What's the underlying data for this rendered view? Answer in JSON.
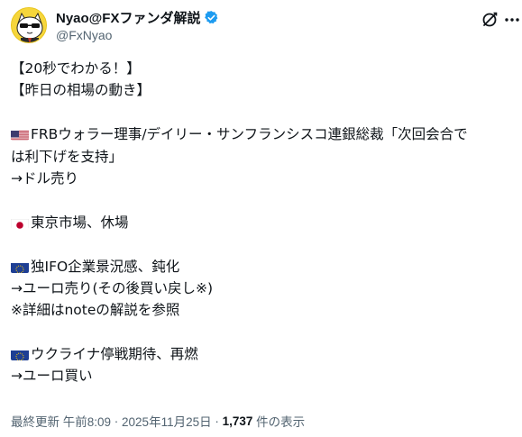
{
  "author": {
    "display_name": "Nyao@FXファンダ解説",
    "handle": "@FxNyao"
  },
  "tweet": {
    "lines": [
      {
        "text": "【20秒でわかる！】"
      },
      {
        "text": "【昨日の相場の動き】"
      },
      {
        "text": ""
      },
      {
        "flag": "us-flag-icon",
        "text": "FRBウォラー理事/デイリー・サンフランシスコ連銀総裁「次回会合で"
      },
      {
        "text": "は利下げを支持」"
      },
      {
        "text": "→ドル売り"
      },
      {
        "text": ""
      },
      {
        "flag": "jp-flag-icon",
        "text": " 東京市場、休場"
      },
      {
        "text": ""
      },
      {
        "flag": "eu-flag-icon",
        "text": "独IFO企業景況感、鈍化"
      },
      {
        "text": "→ユーロ売り(その後買い戻し※)"
      },
      {
        "text": "※詳細はnoteの解説を参照"
      },
      {
        "text": ""
      },
      {
        "flag": "eu-flag-icon",
        "text": "ウクライナ停戦期待、再燃"
      },
      {
        "text": "→ユーロ買い"
      }
    ]
  },
  "footer": {
    "updated_label": "最終更新 午前8:09",
    "separator1": " · ",
    "date": "2025年11月25日",
    "separator2": " · ",
    "views_count": "1,737",
    "views_label": " 件の表示"
  },
  "colors": {
    "verified": "#1d9bf0",
    "text": "#0f1419",
    "muted": "#536471"
  }
}
